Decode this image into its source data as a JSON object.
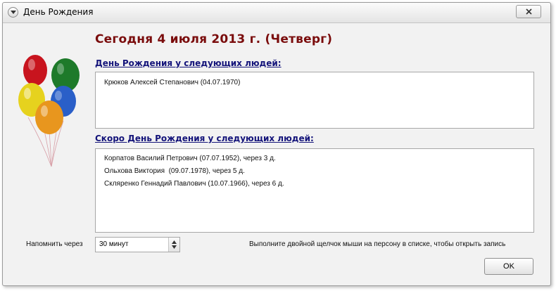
{
  "window": {
    "title": "День Рождения"
  },
  "header": {
    "date_text": "Сегодня 4 июля 2013 г. (Четверг)"
  },
  "today_section": {
    "label": "День Рождения у следующих людей:",
    "items": [
      "Крюков Алексей Степанович (04.07.1970)"
    ]
  },
  "upcoming_section": {
    "label": "Скоро День Рождения у следующих людей:",
    "items": [
      "Корпатов Василий Петрович (07.07.1952), через 3 д.",
      "Ольхова Виктория  (09.07.1978), через 5 д.",
      "Скляренко Геннадий Павлович (10.07.1966), через 6 д."
    ]
  },
  "reminder": {
    "label": "Напомнить через",
    "selected": "30 минут"
  },
  "hint": "Выполните двойной щелчок мыши на персону в списке, чтобы открыть запись",
  "buttons": {
    "ok": "OK"
  },
  "colors": {
    "heading": "#7a0c0c",
    "section_label": "#14147a",
    "balloons": [
      "#c8141e",
      "#1e7a2a",
      "#2a5fc8",
      "#e6d21e",
      "#e8961e"
    ]
  }
}
